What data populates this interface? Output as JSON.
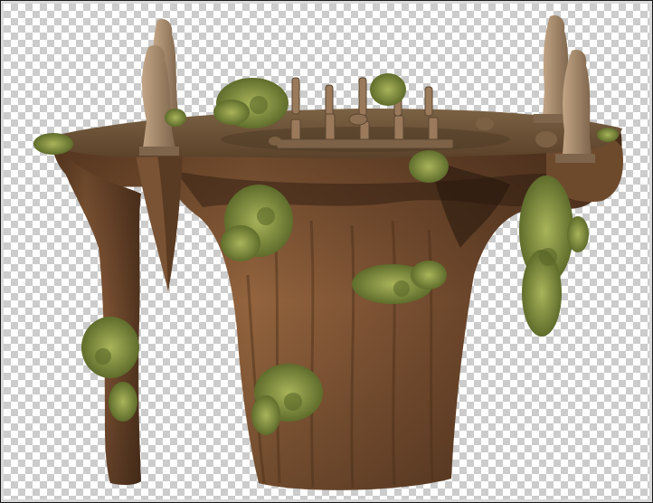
{
  "scene": {
    "subject": "floating-rock-island-with-statues",
    "background": "transparency-checkerboard",
    "colors": {
      "rock_dark": "#5a3a22",
      "rock_mid": "#8a5d3a",
      "rock_light": "#a8774d",
      "top_surface": "#6e5538",
      "moss": "#8a9a4a",
      "moss_dark": "#5d6b2b",
      "statue": "#b39577",
      "statue_dark": "#7b624a"
    }
  }
}
